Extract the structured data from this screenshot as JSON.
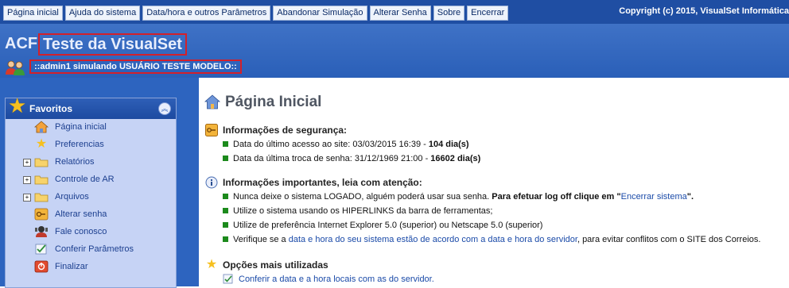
{
  "menu": {
    "items": [
      "Página inicial",
      "Ajuda do sistema",
      "Data/hora e outros Parâmetros",
      "Abandonar Simulação",
      "Alterar Senha",
      "Sobre",
      "Encerrar"
    ],
    "copyright": "Copyright (c) 2015, VisualSet Informática"
  },
  "header": {
    "brand": "ACF",
    "title": "Teste da VisualSet",
    "session": "::admin1 simulando USUÁRIO TESTE MODELO::"
  },
  "favorites": {
    "title": "Favoritos",
    "items": [
      {
        "label": "Página inicial",
        "icon": "home-icon",
        "expandable": false
      },
      {
        "label": "Preferencias",
        "icon": "star-icon",
        "expandable": false
      },
      {
        "label": "Relatórios",
        "icon": "folder-icon",
        "expandable": true
      },
      {
        "label": "Controle de AR",
        "icon": "folder-icon",
        "expandable": true
      },
      {
        "label": "Arquivos",
        "icon": "folder-icon",
        "expandable": true
      },
      {
        "label": "Alterar senha",
        "icon": "key-icon",
        "expandable": false
      },
      {
        "label": "Fale conosco",
        "icon": "contact-icon",
        "expandable": false
      },
      {
        "label": "Conferir Parâmetros",
        "icon": "check-icon",
        "expandable": false
      },
      {
        "label": "Finalizar",
        "icon": "power-icon",
        "expandable": false
      }
    ]
  },
  "main": {
    "title": "Página Inicial",
    "security": {
      "title": "Informações de segurança:",
      "last_access_label": "Data do último acesso ao site:",
      "last_access_date": "03/03/2015 16:39",
      "last_access_days": "104 dia(s)",
      "last_password_label": "Data da última troca de senha:",
      "last_password_date": "31/12/1969 21:00",
      "last_password_days": "16602 dia(s)"
    },
    "important": {
      "title": "Informações importantes, leia com atenção:",
      "b1_text": "Nunca deixe o sistema LOGADO, alguém poderá usar sua senha.",
      "b1_bold": "Para efetuar log off clique em \"",
      "b1_link": "Encerrar sistema",
      "b1_end": "\".",
      "b2_text": "Utilize o sistema usando os HIPERLINKS da barra de ferramentas;",
      "b3_text": "Utilize de preferência Internet Explorer 5.0 (superior) ou Netscape 5.0  (superior)",
      "b4_pre": "Verifique se a",
      "b4_link": "data e hora do seu sistema estão de acordo com a data e hora do servidor",
      "b4_post": ", para evitar conflitos com o SITE dos Correios."
    },
    "options": {
      "title": "Opções mais utilizadas",
      "item1": "Conferir a data e a hora locais com as do servidor."
    }
  },
  "colors": {
    "topbar": "#1f4ea3",
    "header": "#2a5fb8",
    "panel": "#c6d3f5",
    "highlight_border": "#d3202a",
    "bullet": "#1c8a1c",
    "link": "#1a4aa8"
  }
}
